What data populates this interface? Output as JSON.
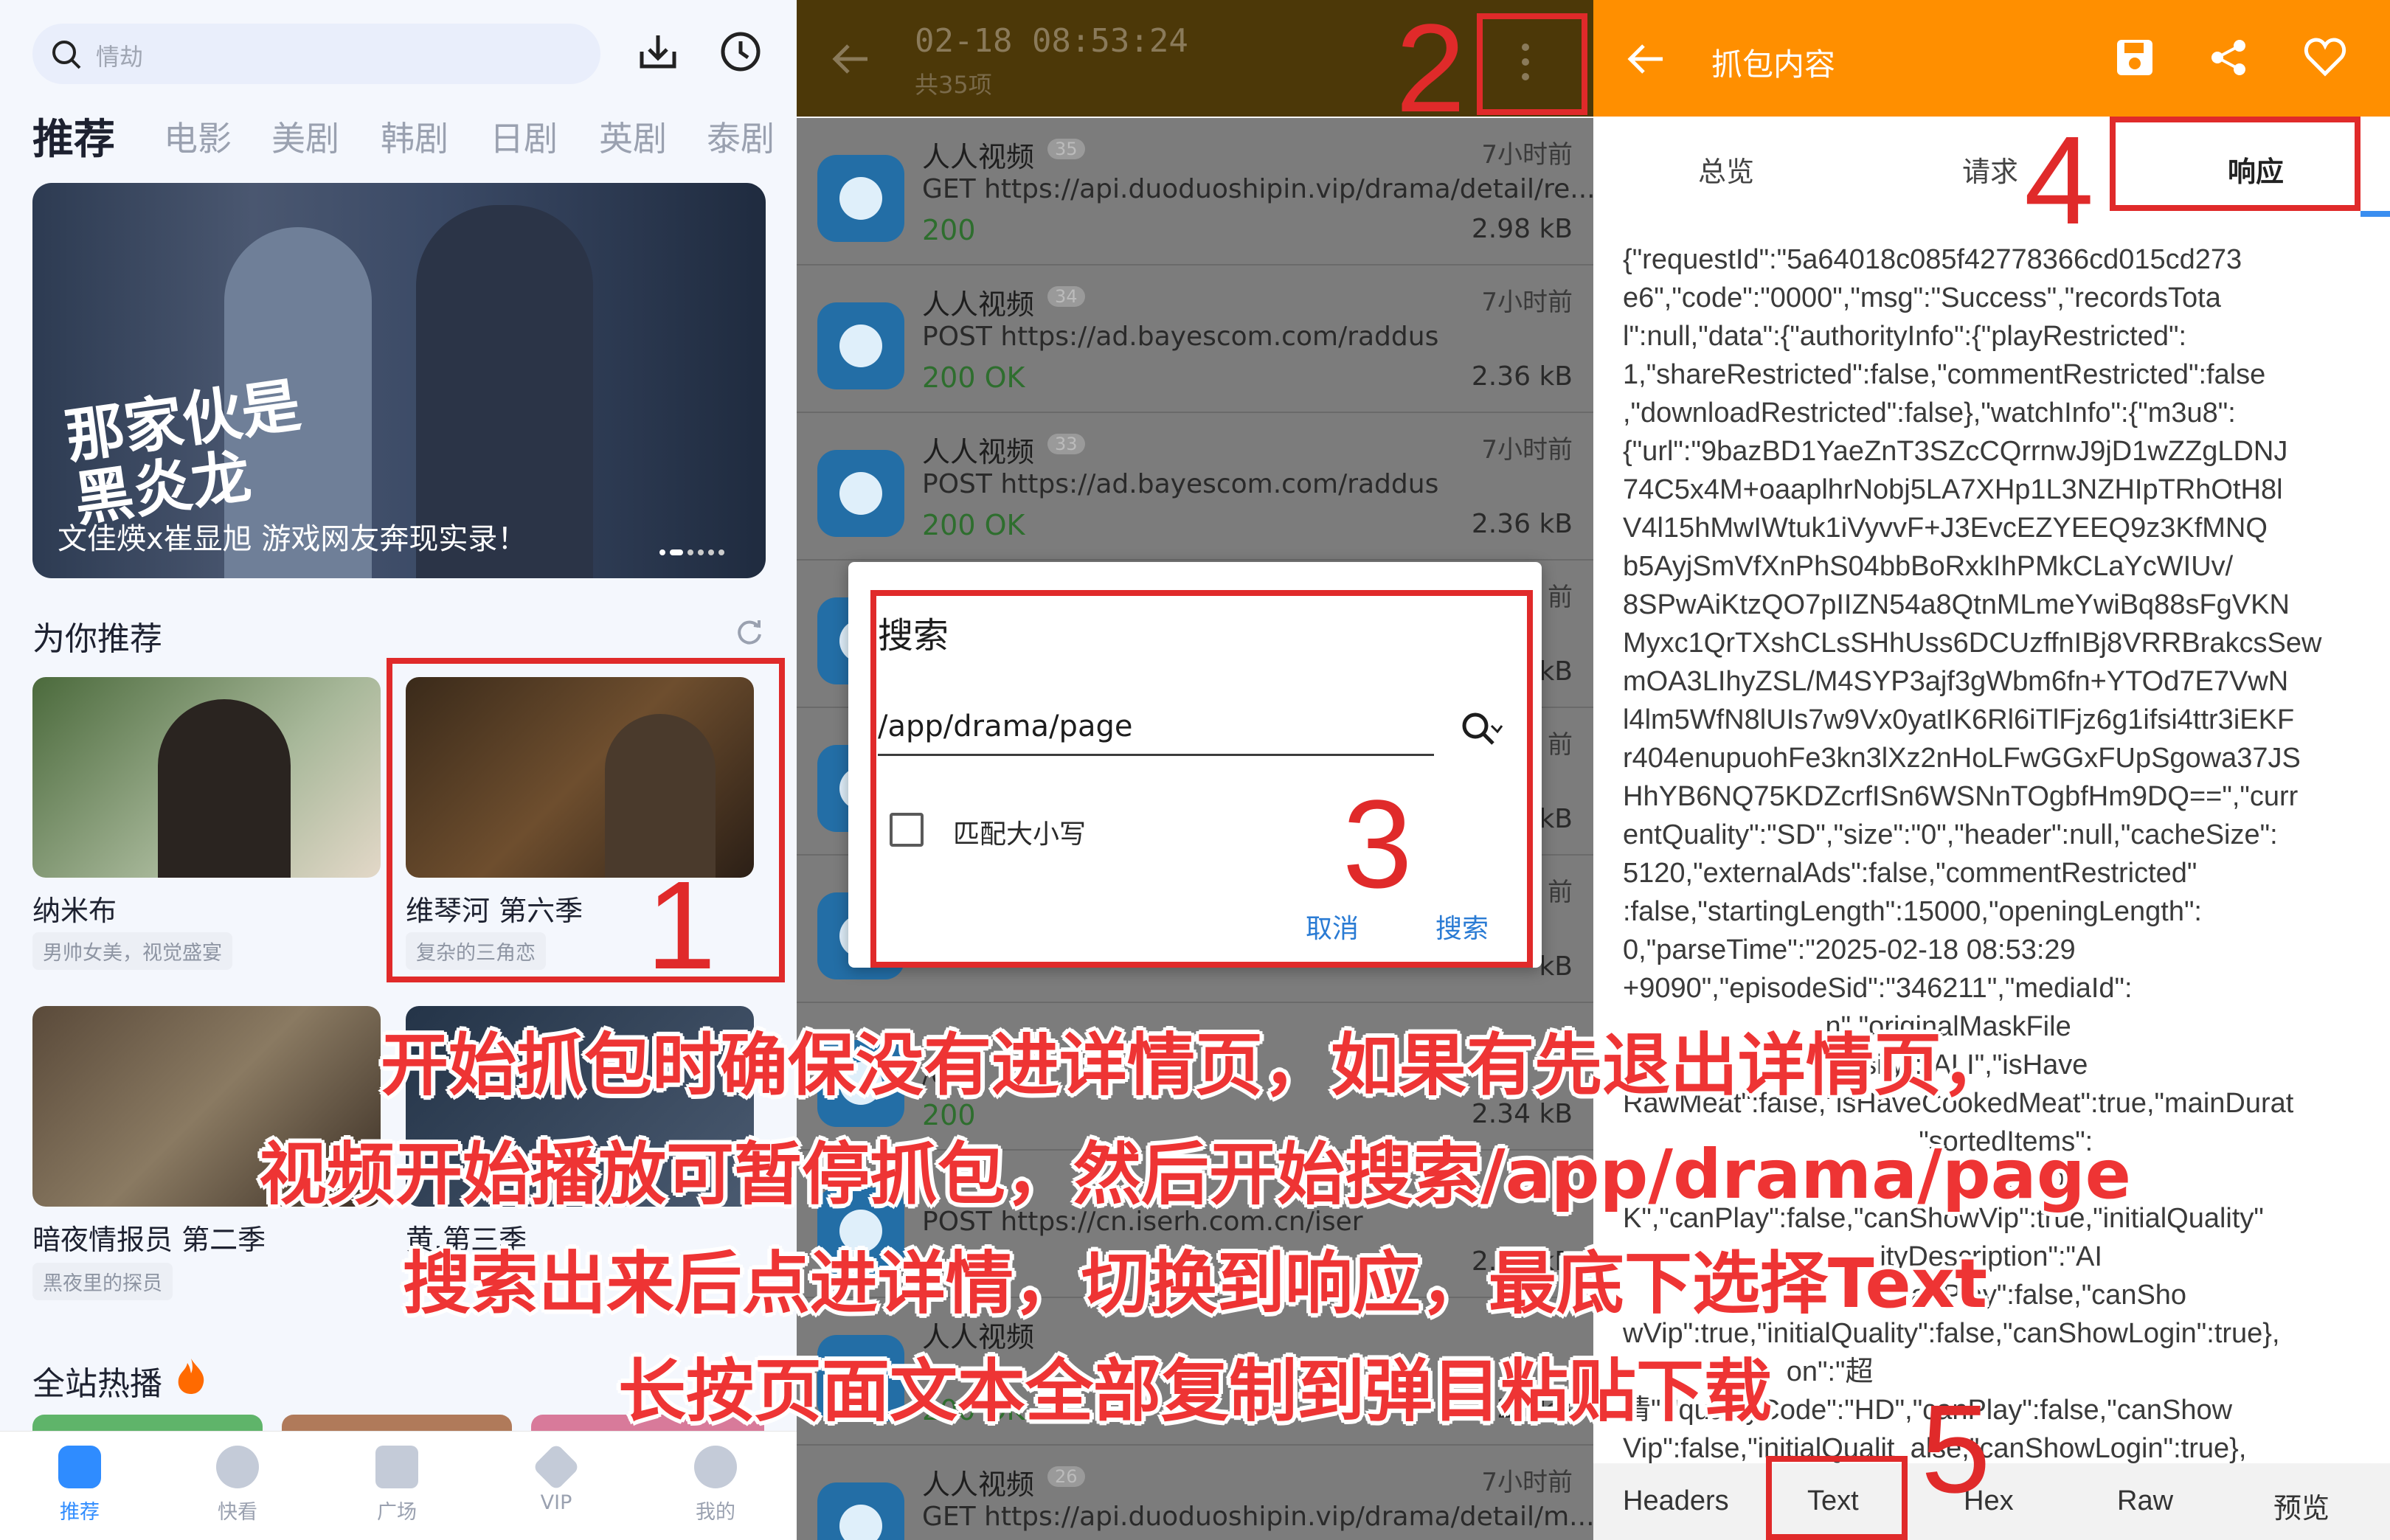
{
  "pane1": {
    "search_placeholder": "情劫",
    "tabs": [
      "推荐",
      "电影",
      "美剧",
      "韩剧",
      "日剧",
      "英剧",
      "泰剧"
    ],
    "banner_title_art": "那家伙是黑炎龙",
    "banner_caption": "文佳煐x崔显旭 游戏网友奔现实录！",
    "section_recommend": "为你推荐",
    "cards": [
      {
        "title": "纳米布",
        "tag": "男帅女美，视觉盛宴"
      },
      {
        "title": "维琴河 第六季",
        "tag": "复杂的三角恋"
      },
      {
        "title": "暗夜情报员 第二季",
        "tag": "黑夜里的探员"
      },
      {
        "title": "黄.第三季",
        "tag": ""
      }
    ],
    "section_hot": "全站热播",
    "nav": [
      "推荐",
      "快看",
      "广场",
      "VIP",
      "我的"
    ]
  },
  "pane2": {
    "header_time": "02-18 08:53:24",
    "header_count": "共35项",
    "rows": [
      {
        "app": "人人视频",
        "badge": "35",
        "time": "7小时前",
        "req": "GET https://api.duoduoshipin.vip/drama/detail/re...",
        "status": "200",
        "size": "2.98 kB"
      },
      {
        "app": "人人视频",
        "badge": "34",
        "time": "7小时前",
        "req": "POST https://ad.bayescom.com/raddus",
        "status": "200 OK",
        "size": "2.36 kB"
      },
      {
        "app": "人人视频",
        "badge": "33",
        "time": "7小时前",
        "req": "POST https://ad.bayescom.com/raddus",
        "status": "200 OK",
        "size": "2.36 kB"
      },
      {
        "app": "",
        "badge": "",
        "time": "前",
        "req": "",
        "status": "",
        "size": "kB"
      },
      {
        "app": "",
        "badge": "",
        "time": "前",
        "req": "...",
        "status": "",
        "size": "kB"
      },
      {
        "app": "",
        "badge": "",
        "time": "前",
        "req": "",
        "status": "",
        "size": "kB"
      },
      {
        "app": "",
        "badge": "",
        "time": "",
        "req": "/dr",
        "status": "200",
        "size": "2.34 kB"
      },
      {
        "app": "",
        "badge": "",
        "time": "",
        "req": "POST https://cn.iserh.com.cn/iser",
        "status": "",
        "size": "2.25 kB"
      },
      {
        "app": "人人视频",
        "badge": "",
        "time": "",
        "req": "",
        "status": "200 OK",
        "size": "2.25 kB"
      },
      {
        "app": "人人视频",
        "badge": "26",
        "time": "7小时前",
        "req": "GET https://api.duoduoshipin.vip/drama/detail/m...",
        "status": "",
        "size": ""
      }
    ],
    "dialog": {
      "title": "搜索",
      "query": "/app/drama/page",
      "checkbox_label": "匹配大小写",
      "cancel": "取消",
      "search": "搜索"
    }
  },
  "pane3": {
    "title": "抓包内容",
    "tabs": [
      "总览",
      "请求",
      "响应"
    ],
    "json_lines": [
      "{\"requestId\":\"5a64018c085f42778366cd015cd273",
      "e6\",\"code\":\"0000\",\"msg\":\"Success\",\"recordsTota",
      "l\":null,\"data\":{\"authorityInfo\":{\"playRestricted\":",
      "1,\"shareRestricted\":false,\"commentRestricted\":false",
      ",\"downloadRestricted\":false},\"watchInfo\":{\"m3u8\":",
      "{\"url\":\"9bazBD1YaeZnT3SZcCQrrnwJ9jD1wZZgLDNJ",
      "74C5x4M+oaaplhrNobj5LA7XHp1L3NZHIpTRhOtH8l",
      "V4l15hMwIWtuk1iVyvvF+J3EvcEZYEEQ9z3KfMNQ",
      "b5AyjSmVfXnPhS04bbBoRxkIhPMkCLaYcWIUv/",
      "8SPwAiKtzQO7pIIZN54a8QtnMLmeYwiBq88sFgVKN",
      "Myxc1QrTXshCLsSHhUss6DCUzffnIBj8VRRBrakcsSew",
      "mOA3LIhyZSL/M4SYP3ajf3gWbm6fn+YTOd7E7VwN",
      "l4lm5WfN8lUIs7w9Vx0yatIK6Rl6iTlFjz6g1ifsi4ttr3iEKF",
      "r404enupuohFe3kn3lXz2nHoLFwGGxFUpSgowa37JS",
      "HhYB6NQ75KDZcrfISn6WSNnTOgbfHm9DQ==\",\"curr",
      "entQuality\":\"SD\",\"size\":\"0\",\"header\":null,\"cacheSize\":",
      "5120,\"externalAds\":false,\"commentRestricted\"",
      ":false,\"startingLength\":15000,\"openingLength\":",
      "0,\"parseTime\":\"2025-02-18 08:53:29",
      "+9090\",\"episodeSid\":\"346211\",\"mediaId\":",
      "                          n\",\"originalMaskFile",
      "                             ssify\":\"ALI\",\"isHave",
      "RawMeat\":false,\"isHaveCookedMeat\":true,\"mainDurat",
      "                                      \"sortedItems\":",
      "                                                 UHD4",
      "K\",\"canPlay\":false,\"canShowVip\":true,\"initialQuality\"",
      "                                 ityDescription\":\"AI",
      "                                     anPlay\":false,\"canSho",
      "wVip\":true,\"initialQuality\":false,\"canShowLogin\":true},",
      "                     on\":\"超",
      "清\",\"qualityCode\":\"HD\",\"canPlay\":false,\"canShow",
      "Vip\":false,\"initialQualit  alse,\"canShowLogin\":true},"
    ],
    "bottom_tabs": [
      "Headers",
      "Text",
      "Hex",
      "Raw",
      "预览"
    ]
  },
  "annotations": {
    "numbers": [
      "1",
      "2",
      "3",
      "4",
      "5"
    ],
    "instructions": [
      "开始抓包时确保没有进详情页，如果有先退出详情页，",
      "视频开始播放可暂停抓包，然后开始搜索/app/drama/page",
      "搜索出来后点进详情，切换到响应，最底下选择Text",
      "长按页面文本全部复制到弹目粘贴下载"
    ]
  },
  "colors": {
    "accent_orange": "#ff8f00",
    "annotation_red": "#e02a2a",
    "link_blue": "#2a7bd4",
    "status_green": "#2e9e3e"
  }
}
